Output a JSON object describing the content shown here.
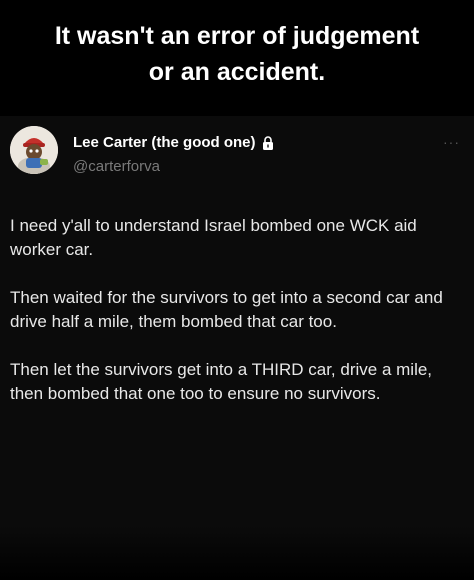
{
  "meme": {
    "headline_line1": "It wasn't an error of judgement",
    "headline_line2": "or an accident."
  },
  "tweet": {
    "display_name": "Lee Carter (the good one)",
    "handle": "@carterforva",
    "lock_icon": "lock-icon",
    "more_icon_glyph": "···",
    "paragraphs": [
      "I need y'all to understand Israel bombed one WCK aid worker car.",
      "Then waited for the survivors to get into a second car and drive half a mile, them bombed that car too.",
      "Then let the survivors get into a THIRD car, drive a mile, then bombed that one too to ensure no survivors."
    ]
  },
  "colors": {
    "background": "#000000",
    "tweet_background": "#0b0b0b",
    "text": "#ffffff",
    "handle": "#7a7a7a"
  }
}
